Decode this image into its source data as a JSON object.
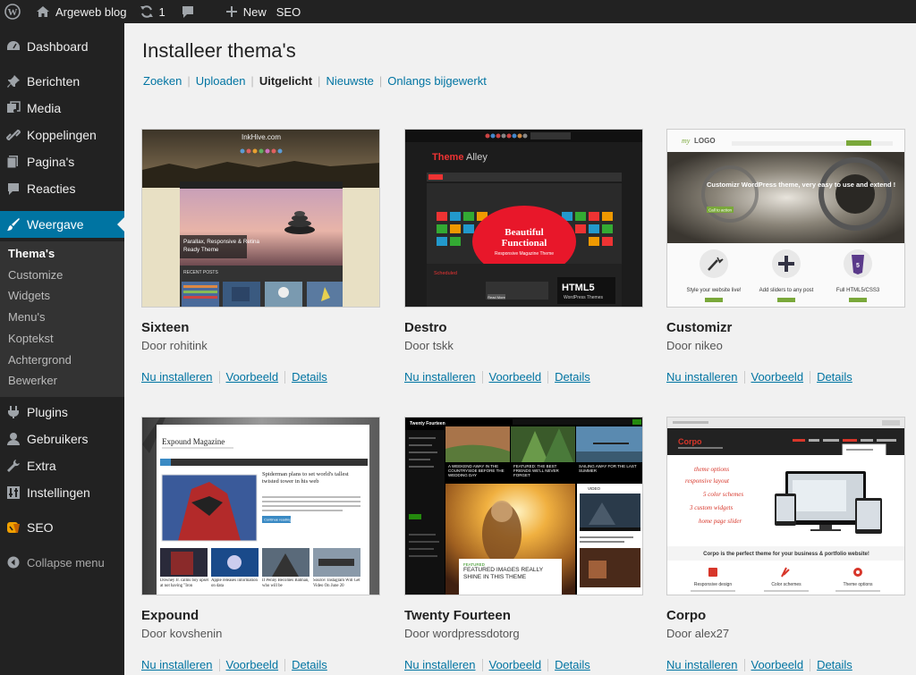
{
  "adminbar": {
    "site_name": "Argeweb blog",
    "updates_count": "1",
    "new_label": "New",
    "seo_label": "SEO",
    "icons": [
      "wordpress-icon",
      "home-icon",
      "updates-icon",
      "comments-icon",
      "plus-icon"
    ]
  },
  "sidebar": {
    "items": [
      {
        "label": "Dashboard",
        "icon": "dashboard-icon"
      },
      {
        "label": "Berichten",
        "icon": "pin-icon"
      },
      {
        "label": "Media",
        "icon": "media-icon"
      },
      {
        "label": "Koppelingen",
        "icon": "link-icon"
      },
      {
        "label": "Pagina's",
        "icon": "page-icon"
      },
      {
        "label": "Reacties",
        "icon": "comment-icon"
      },
      {
        "label": "Weergave",
        "icon": "brush-icon"
      },
      {
        "label": "Plugins",
        "icon": "plug-icon"
      },
      {
        "label": "Gebruikers",
        "icon": "user-icon"
      },
      {
        "label": "Extra",
        "icon": "wrench-icon"
      },
      {
        "label": "Instellingen",
        "icon": "settings-icon"
      },
      {
        "label": "SEO",
        "icon": "seo-icon"
      }
    ],
    "active": "Weergave",
    "submenu": [
      "Thema's",
      "Customize",
      "Widgets",
      "Menu's",
      "Koptekst",
      "Achtergrond",
      "Bewerker"
    ],
    "submenu_current": "Thema's",
    "collapse_label": "Collapse menu"
  },
  "page": {
    "title": "Installeer thema's",
    "filters": [
      "Zoeken",
      "Uploaden",
      "Uitgelicht",
      "Nieuwste",
      "Onlangs bijgewerkt"
    ],
    "current_filter": "Uitgelicht"
  },
  "themes": [
    {
      "name": "Sixteen",
      "author": "Door rohitink",
      "install": "Nu installeren",
      "preview": "Voorbeeld",
      "details": "Details",
      "shot": {
        "header": "InkHive.com",
        "caption1": "Parallax, Responsive & Retina",
        "caption2": "Ready Theme",
        "section": "RECENT POSTS"
      }
    },
    {
      "name": "Destro",
      "author": "Door tskk",
      "install": "Nu installeren",
      "preview": "Voorbeeld",
      "details": "Details",
      "shot": {
        "logo_a": "Theme",
        "logo_b": "Alley",
        "headline1": "Beautiful",
        "headline2": "Functional",
        "sub": "Responsive Magazine Theme",
        "badge": "HTML5",
        "badge_sub": "WordPress Themes",
        "section": "Scheduled",
        "readmore": "Read More"
      }
    },
    {
      "name": "Customizr",
      "author": "Door nikeo",
      "install": "Nu installeren",
      "preview": "Voorbeeld",
      "details": "Details",
      "shot": {
        "logo_a": "my",
        "logo_b": "LOGO",
        "hero": "Customizr WordPress theme, very easy to use and extend !",
        "cta": "Call to action",
        "feat1": "Style your website live!",
        "feat2": "Add sliders to any post",
        "feat3": "Full HTML5/CSS3"
      }
    },
    {
      "name": "Expound",
      "author": "Door kovshenin",
      "install": "Nu installeren",
      "preview": "Voorbeeld",
      "details": "Details",
      "shot": {
        "title": "Expound Magazine",
        "headline": "Spiderman plans to set world's tallest twisted tower in his web",
        "button": "Continue reading →",
        "cap1": "Downey Jr. calms boy upset at not having \"Iron",
        "cap2": "Apple releases information on data",
        "cap3": "If Penny Becomes Batman, who will be",
        "cap4": "Source: Instagram Will Get Video On June 20"
      }
    },
    {
      "name": "Twenty Fourteen",
      "author": "Door wordpressdotorg",
      "install": "Nu installeren",
      "preview": "Voorbeeld",
      "details": "Details",
      "shot": {
        "site": "Twenty Fourteen",
        "post1": "A WEEKEND AWAY IN THE COUNTRYSIDE BEFORE THE WEDDING DAY",
        "post2": "FEATURED: THE BEST FRIENDS WE'LL NEVER FORGET",
        "post3": "SAILING AWAY FOR THE LAST SUMMER",
        "featured_tag": "FEATURED",
        "featured": "FEATURED IMAGES REALLY SHINE IN THIS THEME",
        "video": "VIDEO"
      }
    },
    {
      "name": "Corpo",
      "author": "Door alex27",
      "install": "Nu installeren",
      "preview": "Voorbeeld",
      "details": "Details",
      "shot": {
        "logo": "Corpo",
        "t1": "theme options",
        "t2": "responsive layout",
        "t3": "5 color schemes",
        "t4": "3 custom widgets",
        "t5": "home page slider",
        "tagline": "Corpo is the perfect theme for your business & portfolio website!",
        "f1": "Responsive design",
        "f2": "Color schemes",
        "f3": "Theme options"
      }
    }
  ],
  "colors": {
    "sidebar_bg": "#222222",
    "active_bg": "#0074a2",
    "link": "#0074a2",
    "content_bg": "#f1f1f1"
  }
}
